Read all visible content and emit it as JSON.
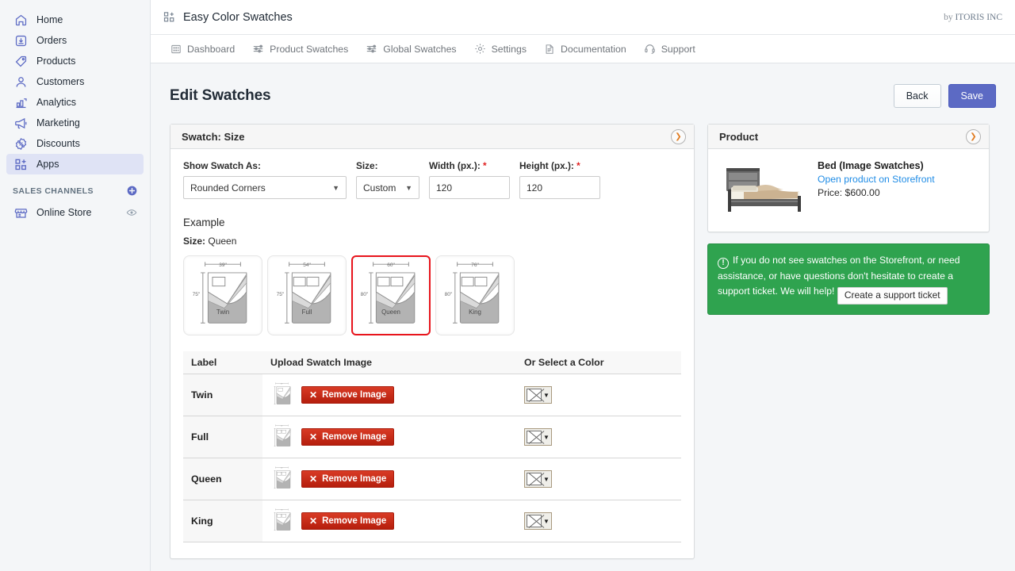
{
  "sidebar": {
    "items": [
      {
        "label": "Home",
        "icon": "home-icon",
        "active": false
      },
      {
        "label": "Orders",
        "icon": "orders-icon",
        "active": false
      },
      {
        "label": "Products",
        "icon": "products-tag-icon",
        "active": false
      },
      {
        "label": "Customers",
        "icon": "customers-icon",
        "active": false
      },
      {
        "label": "Analytics",
        "icon": "analytics-bar-icon",
        "active": false
      },
      {
        "label": "Marketing",
        "icon": "marketing-megaphone-icon",
        "active": false
      },
      {
        "label": "Discounts",
        "icon": "discounts-percent-icon",
        "active": false
      },
      {
        "label": "Apps",
        "icon": "apps-grid-icon",
        "active": true
      }
    ],
    "section_title": "SALES CHANNELS",
    "channel": {
      "label": "Online Store",
      "icon": "storefront-icon",
      "trailing_icon": "eye-icon"
    },
    "add_icon": "plus-circle-icon",
    "active_bg": "#dfe3f5",
    "icon_color": "#5c6ac4"
  },
  "app_bar": {
    "icon": "apps-grid-icon",
    "title": "Easy Color Swatches",
    "byline_prefix": "by ",
    "byline_company": "ITORIS INC"
  },
  "tabs": [
    {
      "label": "Dashboard",
      "icon": "dashboard-grid-icon"
    },
    {
      "label": "Product Swatches",
      "icon": "sliders-icon"
    },
    {
      "label": "Global Swatches",
      "icon": "sliders-icon"
    },
    {
      "label": "Settings",
      "icon": "gear-icon"
    },
    {
      "label": "Documentation",
      "icon": "document-icon"
    },
    {
      "label": "Support",
      "icon": "headset-icon"
    }
  ],
  "page": {
    "title": "Edit Swatches",
    "back_label": "Back",
    "save_label": "Save",
    "primary_color": "#5c6ac4"
  },
  "swatch_card": {
    "title": "Swatch: Size",
    "collapse_icon": "chevron-right-circle-icon",
    "fields": {
      "show_swatch_as": {
        "label": "Show Swatch As:",
        "value": "Rounded Corners"
      },
      "size": {
        "label": "Size:",
        "value": "Custom"
      },
      "width": {
        "label": "Width (px.):",
        "required": "*",
        "value": "120"
      },
      "height": {
        "label": "Height (px.):",
        "required": "*",
        "value": "120"
      }
    },
    "example_title": "Example",
    "example_size_label": "Size:",
    "example_size_value": "Queen",
    "selected_border_color": "#e8141c",
    "previews": [
      {
        "name": "Twin",
        "width_in": "39\"",
        "height_in": "75\"",
        "selected": false,
        "pillows": 1
      },
      {
        "name": "Full",
        "width_in": "54\"",
        "height_in": "75\"",
        "selected": false,
        "pillows": 2
      },
      {
        "name": "Queen",
        "width_in": "60\"",
        "height_in": "80\"",
        "selected": true,
        "pillows": 2
      },
      {
        "name": "King",
        "width_in": "76\"",
        "height_in": "80\"",
        "selected": false,
        "pillows": 2
      }
    ],
    "table": {
      "headers": [
        "Label",
        "Upload Swatch Image",
        "Or Select a Color"
      ],
      "remove_label": "Remove Image",
      "remove_icon": "close-x-icon",
      "color_picker_icon": "no-color-x-icon",
      "color_picker_arrow": "caret-down-icon",
      "rows": [
        {
          "label": "Twin"
        },
        {
          "label": "Full"
        },
        {
          "label": "Queen"
        },
        {
          "label": "King"
        }
      ]
    }
  },
  "product_card": {
    "title": "Product",
    "collapse_icon": "chevron-right-circle-icon",
    "image_alt": "bed-product-photo",
    "name": "Bed (Image Swatches)",
    "link": "Open product on Storefront",
    "price": "Price: $600.00"
  },
  "notice": {
    "icon": "exclamation-circle-icon",
    "text": "If you do not see swatches on the Storefront, or need assistance, or have questions don't hesitate to create a support ticket. We will help!",
    "button_label": "Create a support ticket",
    "background": "#2fa34f"
  }
}
